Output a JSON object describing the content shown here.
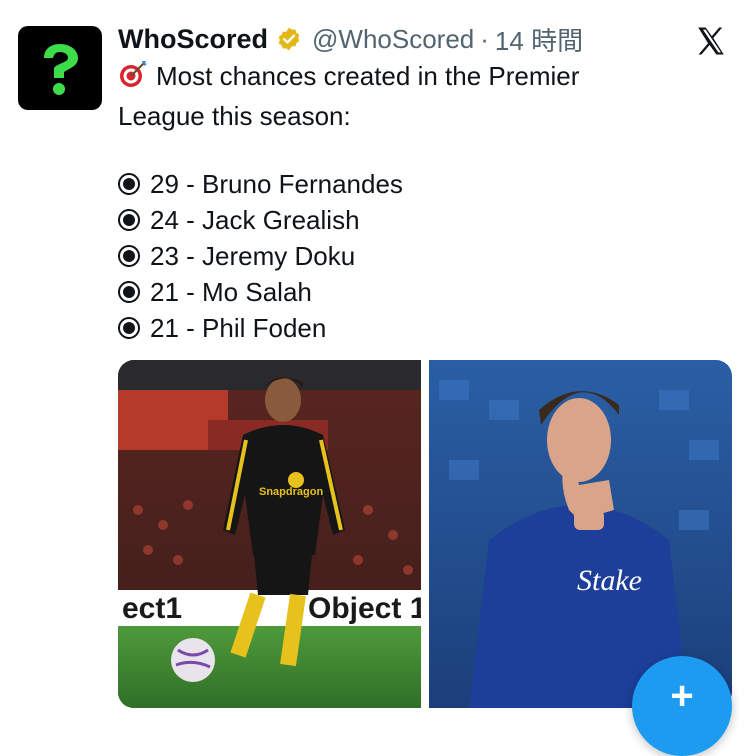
{
  "account": {
    "name": "WhoScored",
    "handle": "@WhoScored",
    "separator": "·",
    "timestamp": "14 時間",
    "verified": true,
    "avatar_icon": "question-mark-icon"
  },
  "tweet": {
    "emoji": "target-emoji",
    "intro_line1": "Most chances created in the Premier",
    "intro_line2": "League this season:",
    "items": [
      {
        "text": "29 - Bruno Fernandes"
      },
      {
        "text": "24 - Jack Grealish"
      },
      {
        "text": "23 - Jeremy Doku"
      },
      {
        "text": "21 - Mo Salah"
      },
      {
        "text": "21 - Phil Foden"
      }
    ]
  },
  "media": {
    "photo1": {
      "shirt_sponsor": "Snapdragon",
      "board_text": "ect1",
      "board_text2": "Object 1"
    },
    "photo2": {
      "shirt_text": "Stake"
    }
  },
  "compose": {
    "icon": "plus-icon",
    "label": "+"
  },
  "colors": {
    "accent": "#1d9bf0",
    "verified": "#e2b719",
    "text": "#0f1419",
    "muted": "#536471",
    "avatar_green": "#3ddc4a"
  }
}
